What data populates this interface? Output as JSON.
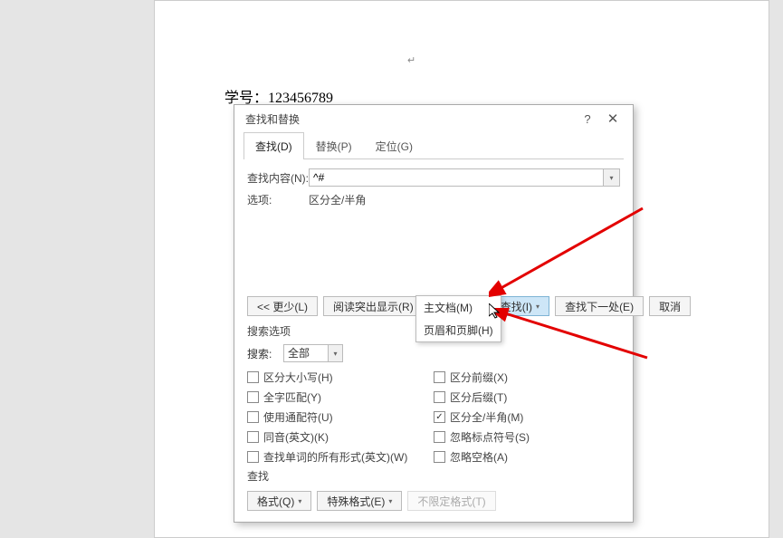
{
  "document": {
    "text": "学号：123456789"
  },
  "dialog": {
    "title": "查找和替换",
    "help": "?",
    "close": "✕",
    "tabs": {
      "find": "查找(D)",
      "replace": "替换(P)",
      "goto": "定位(G)"
    },
    "find_label": "查找内容(N):",
    "find_value": "^#",
    "options_label": "选项:",
    "options_value": "区分全/半角",
    "buttons": {
      "less": "<< 更少(L)",
      "highlight": "阅读突出显示(R)",
      "find_in": "在以下项中查找(I)",
      "find_next": "查找下一处(E)",
      "cancel": "取消"
    },
    "dropdown": {
      "main_doc": "主文档(M)",
      "headers_footers": "页眉和页脚(H)"
    },
    "search_options_label": "搜索选项",
    "search_label": "搜索:",
    "search_value": "全部",
    "checkboxes_left": {
      "match_case": "区分大小写(H)",
      "whole_word": "全字匹配(Y)",
      "wildcards": "使用通配符(U)",
      "sounds_like": "同音(英文)(K)",
      "all_forms": "查找单词的所有形式(英文)(W)"
    },
    "checkboxes_right": {
      "prefix": "区分前缀(X)",
      "suffix": "区分后缀(T)",
      "fullwidth": "区分全/半角(M)",
      "ignore_punct": "忽略标点符号(S)",
      "ignore_space": "忽略空格(A)"
    },
    "find_section_label": "查找",
    "bottom_buttons": {
      "format": "格式(Q)",
      "special": "特殊格式(E)",
      "no_format": "不限定格式(T)"
    }
  }
}
